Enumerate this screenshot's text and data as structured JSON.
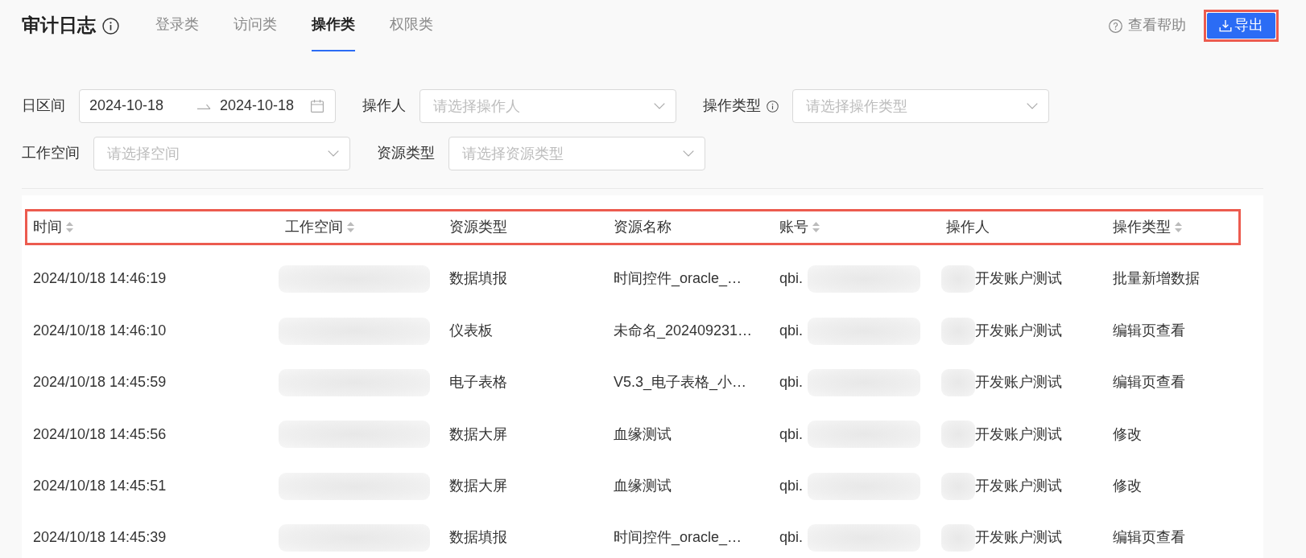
{
  "header": {
    "title": "审计日志",
    "tabs": [
      {
        "label": "登录类",
        "selected": false
      },
      {
        "label": "访问类",
        "selected": false
      },
      {
        "label": "操作类",
        "selected": true
      },
      {
        "label": "权限类",
        "selected": false
      }
    ],
    "help_link": "查看帮助",
    "export_button": {
      "label": "导出",
      "highlighted": true
    }
  },
  "filters": [
    {
      "kind": "date_range",
      "label": "日区间",
      "info": false,
      "start": "2024-10-18",
      "end": "2024-10-18"
    },
    {
      "kind": "select",
      "label": "操作人",
      "info": false,
      "placeholder": "请选择操作人"
    },
    {
      "kind": "select",
      "label": "操作类型",
      "info": true,
      "placeholder": "请选择操作类型"
    },
    {
      "kind": "select",
      "label": "工作空间",
      "info": false,
      "placeholder": "请选择空间"
    },
    {
      "kind": "select",
      "label": "资源类型",
      "info": false,
      "placeholder": "请选择资源类型"
    }
  ],
  "table": {
    "header_highlighted": true,
    "columns": [
      {
        "label": "时间",
        "sortable": true
      },
      {
        "label": "工作空间",
        "sortable": true
      },
      {
        "label": "资源类型",
        "sortable": false
      },
      {
        "label": "资源名称",
        "sortable": false
      },
      {
        "label": "账号",
        "sortable": true
      },
      {
        "label": "操作人",
        "sortable": false
      },
      {
        "label": "操作类型",
        "sortable": true
      }
    ],
    "rows": [
      {
        "cells": [
          [
            {
              "kind": "text",
              "text": "2024/10/18 14:46:19"
            }
          ],
          [
            {
              "kind": "blurred"
            }
          ],
          [
            {
              "kind": "text",
              "text": "数据填报"
            }
          ],
          [
            {
              "kind": "text",
              "text": "时间控件_oracle_…"
            }
          ],
          [
            {
              "kind": "text",
              "text": "qbi."
            },
            {
              "kind": "blurred"
            }
          ],
          [
            {
              "kind": "blurred"
            },
            {
              "kind": "text",
              "text": "开发账户测试"
            }
          ],
          [
            {
              "kind": "text",
              "text": "批量新增数据"
            }
          ]
        ]
      },
      {
        "cells": [
          [
            {
              "kind": "text",
              "text": "2024/10/18 14:46:10"
            }
          ],
          [
            {
              "kind": "blurred"
            }
          ],
          [
            {
              "kind": "text",
              "text": "仪表板"
            }
          ],
          [
            {
              "kind": "text",
              "text": "未命名_202409231…"
            }
          ],
          [
            {
              "kind": "text",
              "text": "qbi."
            },
            {
              "kind": "blurred"
            }
          ],
          [
            {
              "kind": "blurred"
            },
            {
              "kind": "text",
              "text": "开发账户测试"
            }
          ],
          [
            {
              "kind": "text",
              "text": "编辑页查看"
            }
          ]
        ]
      },
      {
        "cells": [
          [
            {
              "kind": "text",
              "text": "2024/10/18 14:45:59"
            }
          ],
          [
            {
              "kind": "blurred"
            }
          ],
          [
            {
              "kind": "text",
              "text": "电子表格"
            }
          ],
          [
            {
              "kind": "text",
              "text": "V5.3_电子表格_小…"
            }
          ],
          [
            {
              "kind": "text",
              "text": "qbi."
            },
            {
              "kind": "blurred"
            }
          ],
          [
            {
              "kind": "blurred"
            },
            {
              "kind": "text",
              "text": "开发账户测试"
            }
          ],
          [
            {
              "kind": "text",
              "text": "编辑页查看"
            }
          ]
        ]
      },
      {
        "cells": [
          [
            {
              "kind": "text",
              "text": "2024/10/18 14:45:56"
            }
          ],
          [
            {
              "kind": "blurred"
            }
          ],
          [
            {
              "kind": "text",
              "text": "数据大屏"
            }
          ],
          [
            {
              "kind": "text",
              "text": "血缘测试"
            }
          ],
          [
            {
              "kind": "text",
              "text": "qbi."
            },
            {
              "kind": "blurred"
            }
          ],
          [
            {
              "kind": "blurred"
            },
            {
              "kind": "text",
              "text": "开发账户测试"
            }
          ],
          [
            {
              "kind": "text",
              "text": "修改"
            }
          ]
        ]
      },
      {
        "cells": [
          [
            {
              "kind": "text",
              "text": "2024/10/18 14:45:51"
            }
          ],
          [
            {
              "kind": "blurred"
            }
          ],
          [
            {
              "kind": "text",
              "text": "数据大屏"
            }
          ],
          [
            {
              "kind": "text",
              "text": "血缘测试"
            }
          ],
          [
            {
              "kind": "text",
              "text": "qbi."
            },
            {
              "kind": "blurred"
            }
          ],
          [
            {
              "kind": "blurred"
            },
            {
              "kind": "text",
              "text": "开发账户测试"
            }
          ],
          [
            {
              "kind": "text",
              "text": "修改"
            }
          ]
        ]
      },
      {
        "cells": [
          [
            {
              "kind": "text",
              "text": "2024/10/18 14:45:39"
            }
          ],
          [
            {
              "kind": "blurred"
            }
          ],
          [
            {
              "kind": "text",
              "text": "数据填报"
            }
          ],
          [
            {
              "kind": "text",
              "text": "时间控件_oracle_…"
            }
          ],
          [
            {
              "kind": "text",
              "text": "qbi."
            },
            {
              "kind": "blurred"
            }
          ],
          [
            {
              "kind": "blurred"
            },
            {
              "kind": "text",
              "text": "开发账户测试"
            }
          ],
          [
            {
              "kind": "text",
              "text": "编辑页查看"
            }
          ]
        ]
      }
    ]
  }
}
